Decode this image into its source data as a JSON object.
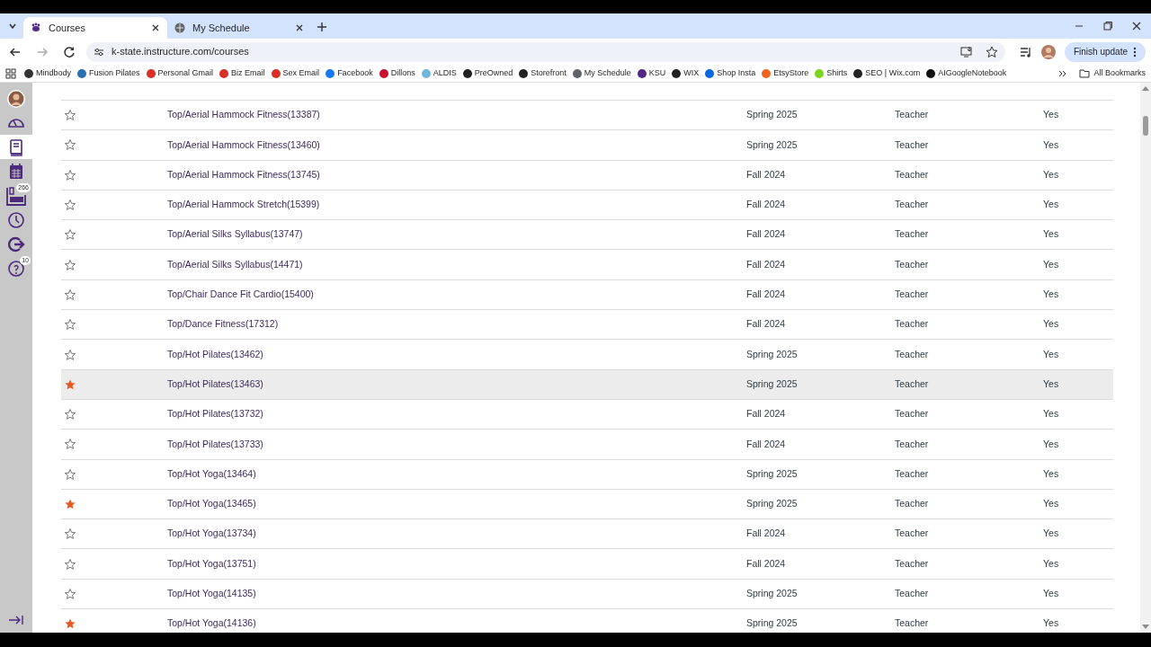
{
  "browser": {
    "tabs": [
      {
        "title": "Courses",
        "selected": true
      },
      {
        "title": "My Schedule",
        "selected": false
      }
    ],
    "url": "k-state.instructure.com/courses",
    "update_button": "Finish update",
    "bookmarks": [
      {
        "label": "Mindbody",
        "color": "#333333"
      },
      {
        "label": "Fusion Pilates",
        "color": "#2a6fb0"
      },
      {
        "label": "Personal Gmail",
        "color": "#d93025"
      },
      {
        "label": "Biz Email",
        "color": "#d93025"
      },
      {
        "label": "Sex Email",
        "color": "#d93025"
      },
      {
        "label": "Facebook",
        "color": "#1877f2"
      },
      {
        "label": "Dillons",
        "color": "#c8102e"
      },
      {
        "label": "ALDIS",
        "color": "#6fb6d9"
      },
      {
        "label": "PreOwned",
        "color": "#222222"
      },
      {
        "label": "Storefront",
        "color": "#222222"
      },
      {
        "label": "My Schedule",
        "color": "#5f6368"
      },
      {
        "label": "KSU",
        "color": "#512888"
      },
      {
        "label": "WIX",
        "color": "#222222"
      },
      {
        "label": "Shop Insta",
        "color": "#0668e1"
      },
      {
        "label": "EtsyStore",
        "color": "#f1641e"
      },
      {
        "label": "Shirts",
        "color": "#7ed321"
      },
      {
        "label": "SEO | Wix.com",
        "color": "#222222"
      },
      {
        "label": "AIGoogleNotebook",
        "color": "#111111"
      }
    ],
    "all_bookmarks": "All Bookmarks"
  },
  "sidebar": {
    "items": [
      {
        "kind": "account",
        "selected": false
      },
      {
        "kind": "dashboard",
        "selected": false
      },
      {
        "kind": "courses",
        "selected": true
      },
      {
        "kind": "calendar",
        "selected": false
      },
      {
        "kind": "inbox",
        "selected": false,
        "badge": "266"
      },
      {
        "kind": "history",
        "selected": false
      },
      {
        "kind": "logout",
        "selected": false
      },
      {
        "kind": "help",
        "selected": false,
        "badge": "10"
      }
    ]
  },
  "table": {
    "rows": [
      {
        "favorite": false,
        "hovered": false,
        "course": "Top/Aerial Hammock Fitness(13387)",
        "term": "Spring 2025",
        "enrolled_as": "Teacher",
        "published": "Yes"
      },
      {
        "favorite": false,
        "hovered": false,
        "course": "Top/Aerial Hammock Fitness(13460)",
        "term": "Spring 2025",
        "enrolled_as": "Teacher",
        "published": "Yes"
      },
      {
        "favorite": false,
        "hovered": false,
        "course": "Top/Aerial Hammock Fitness(13745)",
        "term": "Fall 2024",
        "enrolled_as": "Teacher",
        "published": "Yes"
      },
      {
        "favorite": false,
        "hovered": false,
        "course": "Top/Aerial Hammock Stretch(15399)",
        "term": "Fall 2024",
        "enrolled_as": "Teacher",
        "published": "Yes"
      },
      {
        "favorite": false,
        "hovered": false,
        "course": "Top/Aerial Silks Syllabus(13747)",
        "term": "Fall 2024",
        "enrolled_as": "Teacher",
        "published": "Yes"
      },
      {
        "favorite": false,
        "hovered": false,
        "course": "Top/Aerial Silks Syllabus(14471)",
        "term": "Fall 2024",
        "enrolled_as": "Teacher",
        "published": "Yes"
      },
      {
        "favorite": false,
        "hovered": false,
        "course": "Top/Chair Dance Fit Cardio(15400)",
        "term": "Fall 2024",
        "enrolled_as": "Teacher",
        "published": "Yes"
      },
      {
        "favorite": false,
        "hovered": false,
        "course": "Top/Dance Fitness(17312)",
        "term": "Fall 2024",
        "enrolled_as": "Teacher",
        "published": "Yes"
      },
      {
        "favorite": false,
        "hovered": false,
        "course": "Top/Hot Pilates(13462)",
        "term": "Spring 2025",
        "enrolled_as": "Teacher",
        "published": "Yes"
      },
      {
        "favorite": true,
        "hovered": true,
        "course": "Top/Hot Pilates(13463)",
        "term": "Spring 2025",
        "enrolled_as": "Teacher",
        "published": "Yes"
      },
      {
        "favorite": false,
        "hovered": false,
        "course": "Top/Hot Pilates(13732)",
        "term": "Fall 2024",
        "enrolled_as": "Teacher",
        "published": "Yes"
      },
      {
        "favorite": false,
        "hovered": false,
        "course": "Top/Hot Pilates(13733)",
        "term": "Fall 2024",
        "enrolled_as": "Teacher",
        "published": "Yes"
      },
      {
        "favorite": false,
        "hovered": false,
        "course": "Top/Hot Yoga(13464)",
        "term": "Spring 2025",
        "enrolled_as": "Teacher",
        "published": "Yes"
      },
      {
        "favorite": true,
        "hovered": false,
        "course": "Top/Hot Yoga(13465)",
        "term": "Spring 2025",
        "enrolled_as": "Teacher",
        "published": "Yes"
      },
      {
        "favorite": false,
        "hovered": false,
        "course": "Top/Hot Yoga(13734)",
        "term": "Fall 2024",
        "enrolled_as": "Teacher",
        "published": "Yes"
      },
      {
        "favorite": false,
        "hovered": false,
        "course": "Top/Hot Yoga(13751)",
        "term": "Fall 2024",
        "enrolled_as": "Teacher",
        "published": "Yes"
      },
      {
        "favorite": false,
        "hovered": false,
        "course": "Top/Hot Yoga(14135)",
        "term": "Spring 2025",
        "enrolled_as": "Teacher",
        "published": "Yes"
      },
      {
        "favorite": true,
        "hovered": false,
        "course": "Top/Hot Yoga(14136)",
        "term": "Spring 2025",
        "enrolled_as": "Teacher",
        "published": "Yes"
      }
    ]
  }
}
